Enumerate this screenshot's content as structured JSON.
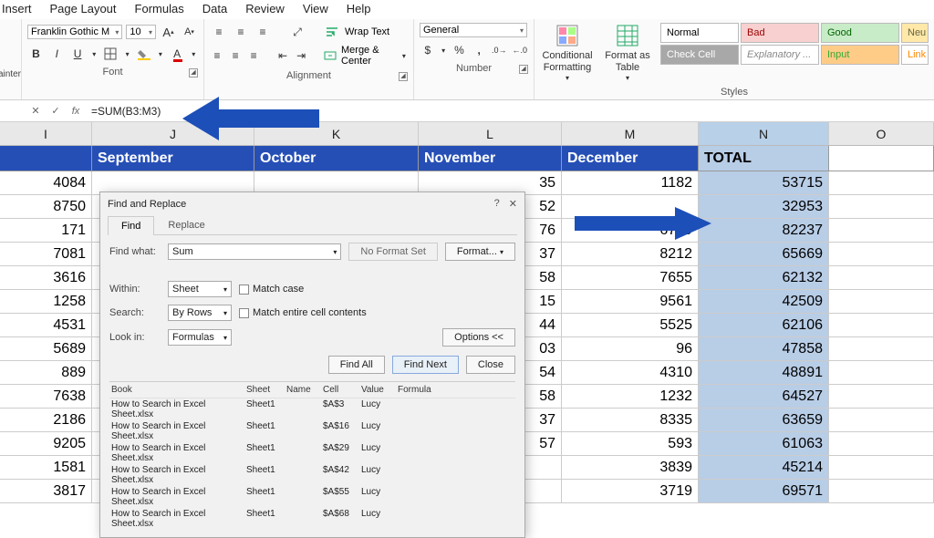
{
  "menu": {
    "items": [
      "Insert",
      "Page Layout",
      "Formulas",
      "Data",
      "Review",
      "View",
      "Help"
    ]
  },
  "painter_label": "ainter",
  "ribbon": {
    "font": {
      "label": "Font",
      "family": "Franklin Gothic M",
      "size": "10",
      "bold": "B",
      "italic": "I",
      "underline": "U"
    },
    "alignment": {
      "label": "Alignment",
      "wrap": "Wrap Text",
      "merge": "Merge & Center"
    },
    "number": {
      "label": "Number",
      "format": "General"
    },
    "styles": {
      "label": "Styles",
      "cond": "Conditional Formatting",
      "table": "Format as Table",
      "normal": "Normal",
      "bad": "Bad",
      "good": "Good",
      "neutral": "Neu",
      "check": "Check Cell",
      "expl": "Explanatory ...",
      "input": "Input",
      "link": "Link"
    }
  },
  "formula_bar": {
    "fx": "fx",
    "formula": "=SUM(B3:M3)"
  },
  "columns": [
    "I",
    "J",
    "K",
    "L",
    "M",
    "N",
    "O"
  ],
  "months": [
    "",
    "September",
    "October",
    "November",
    "December",
    "TOTAL",
    ""
  ],
  "rows": [
    {
      "i": "4084",
      "l_tail": "35",
      "m": "1182",
      "n": "53715"
    },
    {
      "i": "8750",
      "l_tail": "52",
      "m": "",
      "n": "32953"
    },
    {
      "i": "171",
      "l_tail": "76",
      "m": "6779",
      "n": "82237"
    },
    {
      "i": "7081",
      "l_tail": "37",
      "m": "8212",
      "n": "65669"
    },
    {
      "i": "3616",
      "l_tail": "58",
      "m": "7655",
      "n": "62132"
    },
    {
      "i": "1258",
      "l_tail": "15",
      "m": "9561",
      "n": "42509"
    },
    {
      "i": "4531",
      "l_tail": "44",
      "m": "5525",
      "n": "62106"
    },
    {
      "i": "5689",
      "l_tail": "03",
      "m": "96",
      "n": "47858"
    },
    {
      "i": "889",
      "l_tail": "54",
      "m": "4310",
      "n": "48891"
    },
    {
      "i": "7638",
      "l_tail": "58",
      "m": "1232",
      "n": "64527"
    },
    {
      "i": "2186",
      "l_tail": "37",
      "m": "8335",
      "n": "63659"
    },
    {
      "i": "9205",
      "l_tail": "57",
      "m": "593",
      "n": "61063"
    },
    {
      "i": "1581",
      "l_tail": "",
      "m": "3839",
      "n": "45214"
    },
    {
      "i": "3817",
      "l_tail": "",
      "m": "3719",
      "n": "69571"
    }
  ],
  "dialog": {
    "title": "Find and Replace",
    "tabs": {
      "find": "Find",
      "replace": "Replace"
    },
    "find_what_label": "Find what:",
    "find_what_value": "Sum",
    "no_format": "No Format Set",
    "format_btn": "Format...",
    "within_label": "Within:",
    "within_value": "Sheet",
    "search_label": "Search:",
    "search_value": "By Rows",
    "lookin_label": "Look in:",
    "lookin_value": "Formulas",
    "match_case": "Match case",
    "match_entire": "Match entire cell contents",
    "options": "Options <<",
    "find_all": "Find All",
    "find_next": "Find Next",
    "close": "Close",
    "results_header": {
      "book": "Book",
      "sheet": "Sheet",
      "name": "Name",
      "cell": "Cell",
      "value": "Value",
      "formula": "Formula"
    },
    "results": [
      {
        "book": "How to Search in Excel Sheet.xlsx",
        "sheet": "Sheet1",
        "name": "",
        "cell": "$A$3",
        "value": "Lucy",
        "formula": ""
      },
      {
        "book": "How to Search in Excel Sheet.xlsx",
        "sheet": "Sheet1",
        "name": "",
        "cell": "$A$16",
        "value": "Lucy",
        "formula": ""
      },
      {
        "book": "How to Search in Excel Sheet.xlsx",
        "sheet": "Sheet1",
        "name": "",
        "cell": "$A$29",
        "value": "Lucy",
        "formula": ""
      },
      {
        "book": "How to Search in Excel Sheet.xlsx",
        "sheet": "Sheet1",
        "name": "",
        "cell": "$A$42",
        "value": "Lucy",
        "formula": ""
      },
      {
        "book": "How to Search in Excel Sheet.xlsx",
        "sheet": "Sheet1",
        "name": "",
        "cell": "$A$55",
        "value": "Lucy",
        "formula": ""
      },
      {
        "book": "How to Search in Excel Sheet.xlsx",
        "sheet": "Sheet1",
        "name": "",
        "cell": "$A$68",
        "value": "Lucy",
        "formula": ""
      }
    ]
  }
}
